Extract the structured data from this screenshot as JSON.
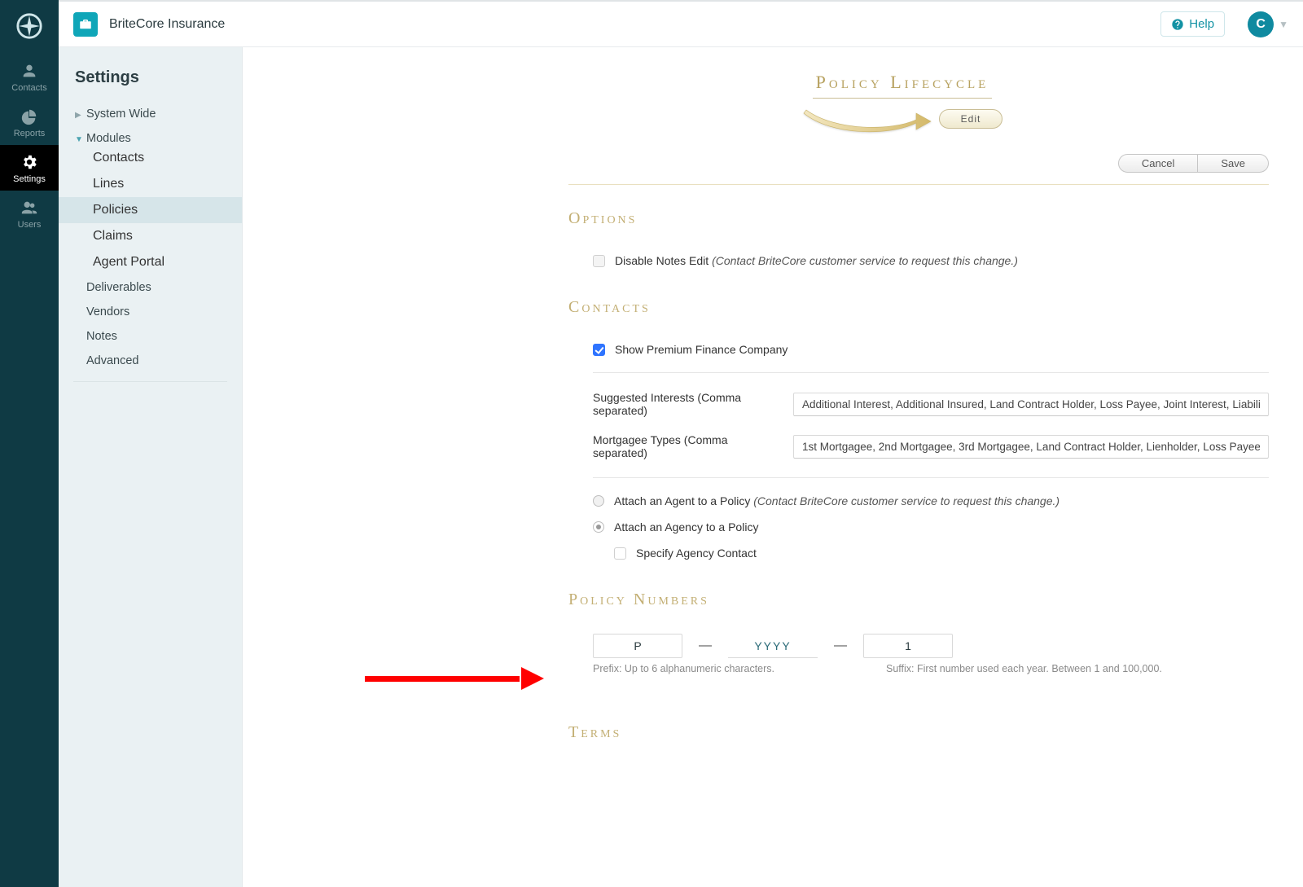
{
  "brand": {
    "title": "BriteCore Insurance",
    "help_label": "Help",
    "avatar_initial": "C"
  },
  "rail": {
    "items": [
      {
        "label": "Contacts"
      },
      {
        "label": "Reports"
      },
      {
        "label": "Settings"
      },
      {
        "label": "Users"
      }
    ]
  },
  "settings_nav": {
    "title": "Settings",
    "system_wide": "System Wide",
    "modules": "Modules",
    "modules_children": {
      "contacts": "Contacts",
      "lines": "Lines",
      "policies": "Policies",
      "claims": "Claims",
      "agent_portal": "Agent Portal"
    },
    "deliverables": "Deliverables",
    "vendors": "Vendors",
    "notes": "Notes",
    "advanced": "Advanced"
  },
  "lifecycle": {
    "title": "Policy Lifecycle",
    "edit": "Edit"
  },
  "actions": {
    "cancel": "Cancel",
    "save": "Save"
  },
  "sections": {
    "options": "Options",
    "contacts": "Contacts",
    "policy_numbers": "Policy Numbers",
    "terms": "Terms"
  },
  "options": {
    "disable_notes_label": "Disable Notes Edit",
    "disable_notes_hint": "(Contact BriteCore customer service to request this change.)"
  },
  "contacts": {
    "show_pfc": "Show Premium Finance Company",
    "suggested_label": "Suggested Interests (Comma separated)",
    "suggested_value": "Additional Interest, Additional Insured, Land Contract Holder, Loss Payee, Joint Interest, Liability Interest",
    "mortgagee_label": "Mortgagee Types (Comma separated)",
    "mortgagee_value": "1st Mortgagee, 2nd Mortgagee, 3rd Mortgagee, Land Contract Holder, Lienholder, Loss Payee",
    "attach_agent_label": "Attach an Agent to a Policy",
    "attach_agent_hint": "(Contact BriteCore customer service to request this change.)",
    "attach_agency_label": "Attach an Agency to a Policy",
    "specify_agency_contact": "Specify Agency Contact"
  },
  "policy_numbers": {
    "prefix_value": "P",
    "year_placeholder": "YYYY",
    "suffix_value": "1",
    "prefix_help": "Prefix: Up to 6 alphanumeric characters.",
    "suffix_help": "Suffix: First number used each year. Between 1 and 100,000."
  }
}
